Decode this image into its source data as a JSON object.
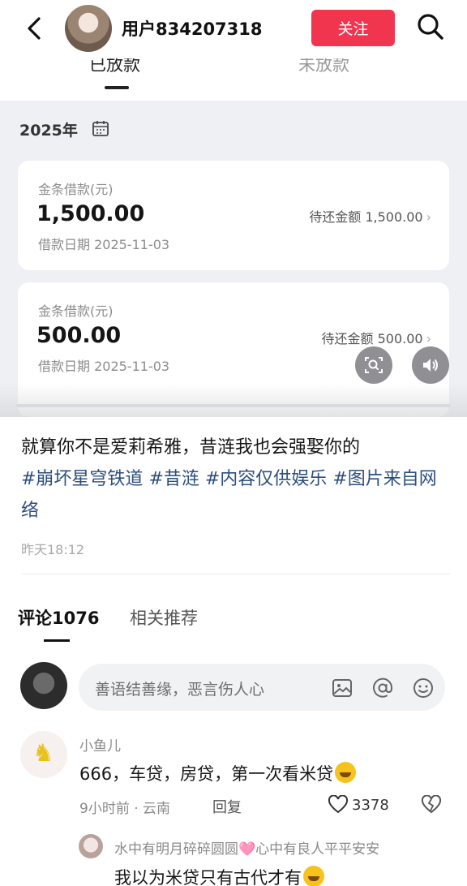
{
  "header": {
    "username": "用户834207318",
    "follow_label": "关注"
  },
  "screenshot": {
    "subtabs": [
      "已放款",
      "未放款"
    ],
    "year": "2025年",
    "loans": [
      {
        "type": "金条借款(元)",
        "amount": "1,500.00",
        "date": "借款日期 2025-11-03",
        "due": "待还金额 1,500.00"
      },
      {
        "type": "金条借款(元)",
        "amount": "500.00",
        "date": "借款日期 2025-11-03",
        "due": "待还金额 500.00"
      }
    ]
  },
  "post": {
    "caption": "就算你不是爱莉希雅，昔涟我也会强娶你的",
    "hashtags": [
      "#崩坏星穹铁道",
      "#昔涟",
      "#内容仅供娱乐",
      "#图片来自网络"
    ],
    "time": "昨天18:12"
  },
  "comment_tabs": {
    "comments": "评论1076",
    "related": "相关推荐"
  },
  "comment_input": {
    "placeholder": "善语结善缘，恶言伤人心"
  },
  "comment": {
    "name": "小鱼儿",
    "text": "666，车贷，房贷，第一次看米贷",
    "meta": "9小时前 · 云南",
    "reply_label": "回复",
    "likes": "3378"
  },
  "reply": {
    "name": "水中有明月碎碎圆圆🩷心中有良人平平安安",
    "text": "我以为米贷只有古代才有"
  },
  "colors": {
    "follow": "#f2354f",
    "hashtag": "#2d4f7e"
  }
}
